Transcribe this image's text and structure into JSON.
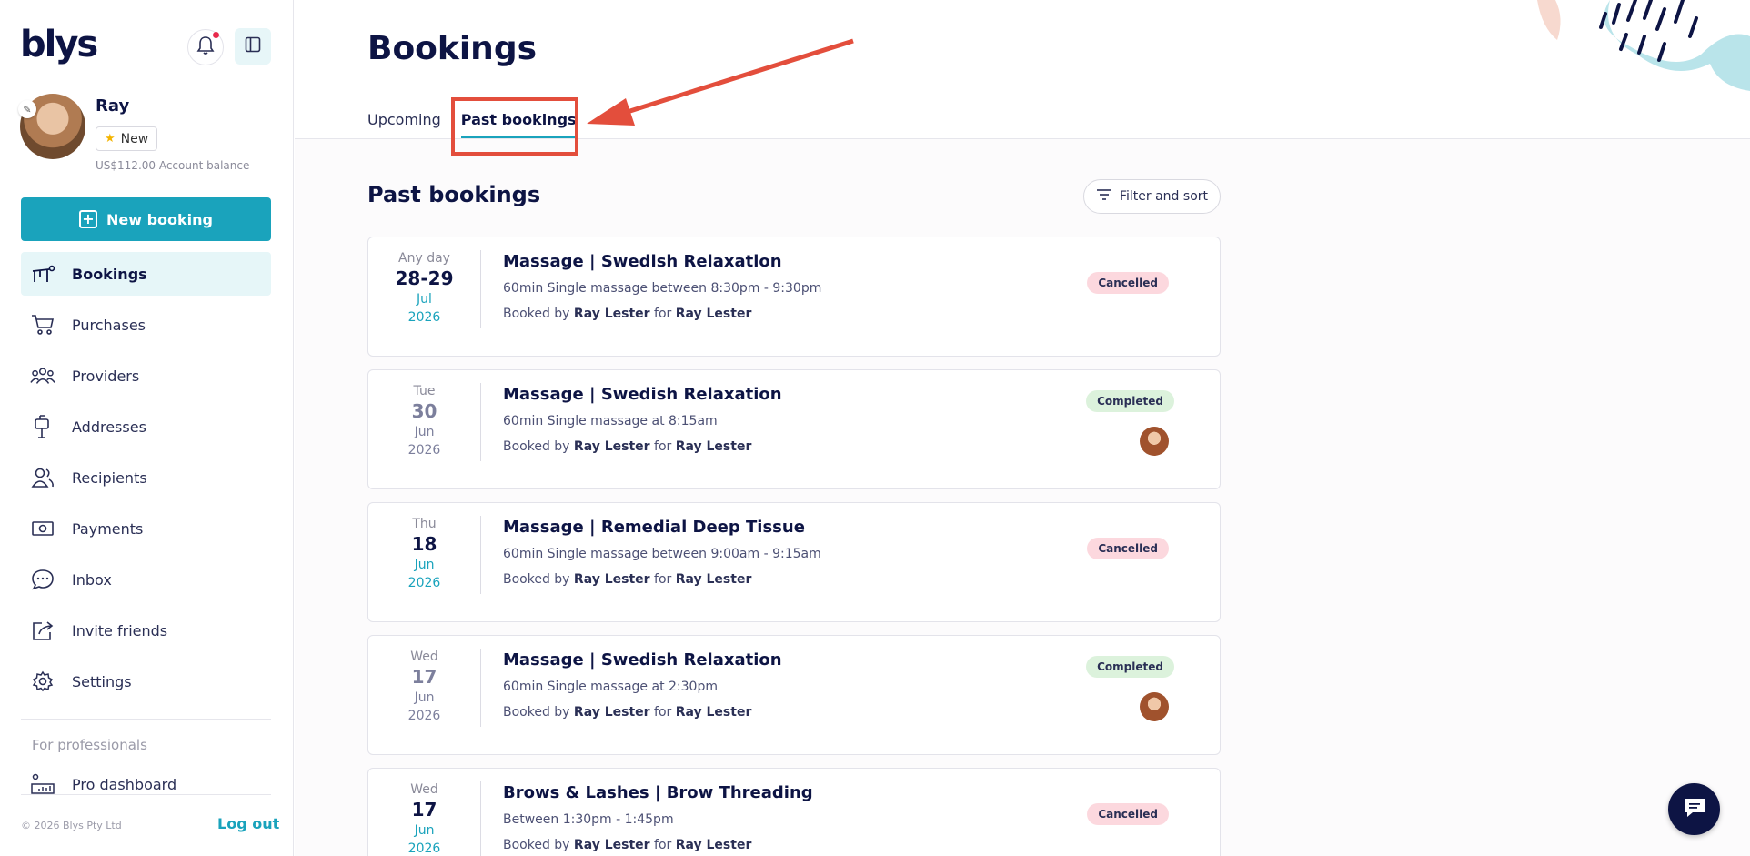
{
  "brand": {
    "logo": "blys",
    "accent": "#1aa3bc",
    "navy": "#0d1444"
  },
  "user": {
    "name": "Ray",
    "badge": "New",
    "balance": "US$112.00 Account balance"
  },
  "sidebar": {
    "new_booking": "New booking",
    "items": [
      {
        "label": "Bookings",
        "icon": "massage-table-icon",
        "active": true
      },
      {
        "label": "Purchases",
        "icon": "cart-icon"
      },
      {
        "label": "Providers",
        "icon": "people-group-icon"
      },
      {
        "label": "Addresses",
        "icon": "mailbox-icon"
      },
      {
        "label": "Recipients",
        "icon": "users-icon"
      },
      {
        "label": "Payments",
        "icon": "money-icon"
      },
      {
        "label": "Inbox",
        "icon": "chat-bubble-icon"
      },
      {
        "label": "Invite friends",
        "icon": "share-icon"
      },
      {
        "label": "Settings",
        "icon": "gear-icon"
      }
    ],
    "for_professionals": "For professionals",
    "pro_dashboard": "Pro dashboard",
    "copyright": "© 2026 Blys Pty Ltd",
    "logout": "Log out"
  },
  "main": {
    "title": "Bookings",
    "tabs": [
      {
        "label": "Upcoming"
      },
      {
        "label": "Past bookings",
        "active": true
      }
    ],
    "section_title": "Past bookings",
    "filter_label": "Filter and sort",
    "bookings": [
      {
        "day": "Any day",
        "date": "28-29",
        "month": "Jul",
        "year": "2026",
        "title": "Massage | Swedish Relaxation",
        "desc": "60min Single massage between 8:30pm - 9:30pm",
        "by_prefix": "Booked by",
        "booked_by": "Ray Lester",
        "for_word": "for",
        "recipient": "Ray Lester",
        "status": "Cancelled"
      },
      {
        "day": "Tue",
        "date": "30",
        "month": "Jun",
        "year": "2026",
        "title": "Massage | Swedish Relaxation",
        "desc": "60min Single massage at 8:15am",
        "by_prefix": "Booked by",
        "booked_by": "Ray Lester",
        "for_word": "for",
        "recipient": "Ray Lester",
        "status": "Completed"
      },
      {
        "day": "Thu",
        "date": "18",
        "month": "Jun",
        "year": "2026",
        "title": "Massage | Remedial Deep Tissue",
        "desc": "60min Single massage between 9:00am - 9:15am",
        "by_prefix": "Booked by",
        "booked_by": "Ray Lester",
        "for_word": "for",
        "recipient": "Ray Lester",
        "status": "Cancelled"
      },
      {
        "day": "Wed",
        "date": "17",
        "month": "Jun",
        "year": "2026",
        "title": "Massage | Swedish Relaxation",
        "desc": "60min Single massage at 2:30pm",
        "by_prefix": "Booked by",
        "booked_by": "Ray Lester",
        "for_word": "for",
        "recipient": "Ray Lester",
        "status": "Completed"
      },
      {
        "day": "Wed",
        "date": "17",
        "month": "Jun",
        "year": "2026",
        "title": "Brows & Lashes | Brow Threading",
        "desc": "Between 1:30pm - 1:45pm",
        "by_prefix": "Booked by",
        "booked_by": "Ray Lester",
        "for_word": "for",
        "recipient": "Ray Lester",
        "status": "Cancelled"
      }
    ]
  }
}
